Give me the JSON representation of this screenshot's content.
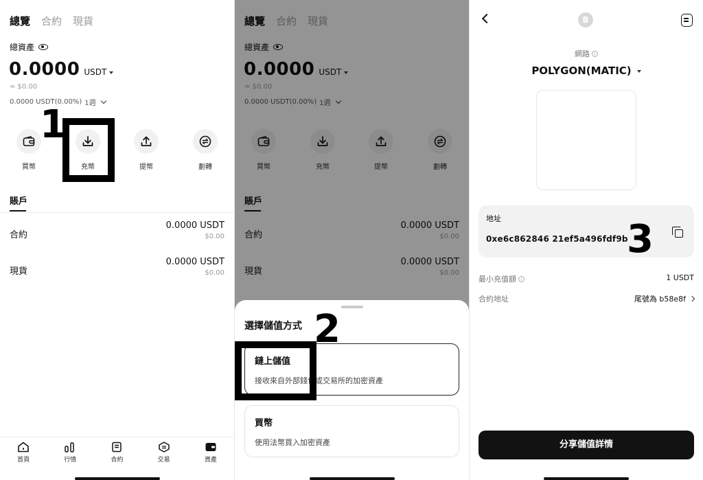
{
  "panel1": {
    "tabs": [
      "總覽",
      "合約",
      "現貨"
    ],
    "total_label": "總資產",
    "total_amount": "0.0000",
    "total_currency": "USDT",
    "approx": "≈ $0.00",
    "pnl": "0.0000 USDT(0.00%)",
    "period": "1週",
    "actions": [
      "買幣",
      "充幣",
      "提幣",
      "劃轉"
    ],
    "accounts_title": "賬戶",
    "accounts": [
      {
        "name": "合約",
        "value": "0.0000 USDT",
        "fiat": "$0.00"
      },
      {
        "name": "現貨",
        "value": "0.0000 USDT",
        "fiat": "$0.00"
      }
    ],
    "nav": [
      "首頁",
      "行情",
      "合約",
      "交易",
      "資產"
    ],
    "step_number": "1"
  },
  "panel2": {
    "sheet_title": "選擇儲值方式",
    "options": [
      {
        "title": "鏈上儲值",
        "desc": "接收來自外部錢包或交易所的加密資產"
      },
      {
        "title": "買幣",
        "desc": "使用法幣買入加密資產"
      }
    ],
    "step_number": "2"
  },
  "panel3": {
    "coin_glyph": "B",
    "network_label": "網路",
    "network_value": "POLYGON(MATIC)",
    "address_label": "地址",
    "address_value": "0xe6c862846 21ef5a496fdf9b",
    "min_deposit_label": "最小充值額",
    "min_deposit_value": "1 USDT",
    "contract_label": "合約地址",
    "contract_value": "尾號為 b58e8f",
    "share_button": "分享儲值詳情",
    "step_number": "3"
  },
  "colors": {
    "primary_dark": "#121212",
    "overlay": "rgba(0,0,0,0.42)",
    "card_bg": "#f2f2f2"
  }
}
